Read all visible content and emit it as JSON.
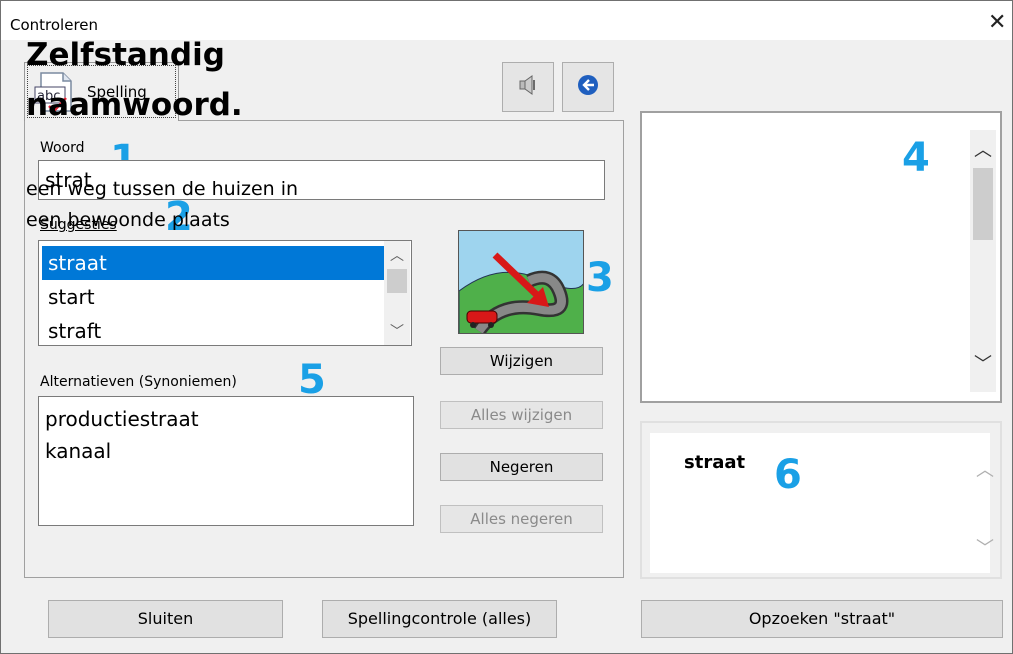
{
  "window": {
    "title": "Controleren",
    "close_glyph": "✕"
  },
  "tabs": [
    {
      "label": "Spelling",
      "icon": "abc-spellcheck-icon"
    }
  ],
  "toolbar": {
    "speaker_icon": "speaker-icon",
    "back_icon": "back-arrow-icon"
  },
  "word": {
    "label": "Woord",
    "value": "strat",
    "marker": "1"
  },
  "suggestions": {
    "label": "Suggesties",
    "marker": "2",
    "items": [
      "straat",
      "start",
      "straft"
    ],
    "selected": "straat"
  },
  "picture": {
    "marker": "3",
    "icon": "road-with-car-icon"
  },
  "alternatives": {
    "label": "Alternatieven (Synoniemen)",
    "marker": "5",
    "items": [
      "productiestraat",
      "kanaal"
    ]
  },
  "actions": {
    "change": "Wijzigen",
    "change_all": "Alles wijzigen",
    "ignore": "Negeren",
    "ignore_all": "Alles negeren"
  },
  "definition": {
    "marker": "4",
    "heading": "Zelfstandig naamwoord.",
    "text": "een weg tussen de huizen in een bewoonde plaats"
  },
  "lookup_word": {
    "marker": "6",
    "word": "straat"
  },
  "footer": {
    "close": "Sluiten",
    "spellcheck_all": "Spellingcontrole (alles)",
    "lookup": "Opzoeken \"straat\""
  },
  "colors": {
    "accent": "#0078d7",
    "marker": "#1aa0e6"
  }
}
